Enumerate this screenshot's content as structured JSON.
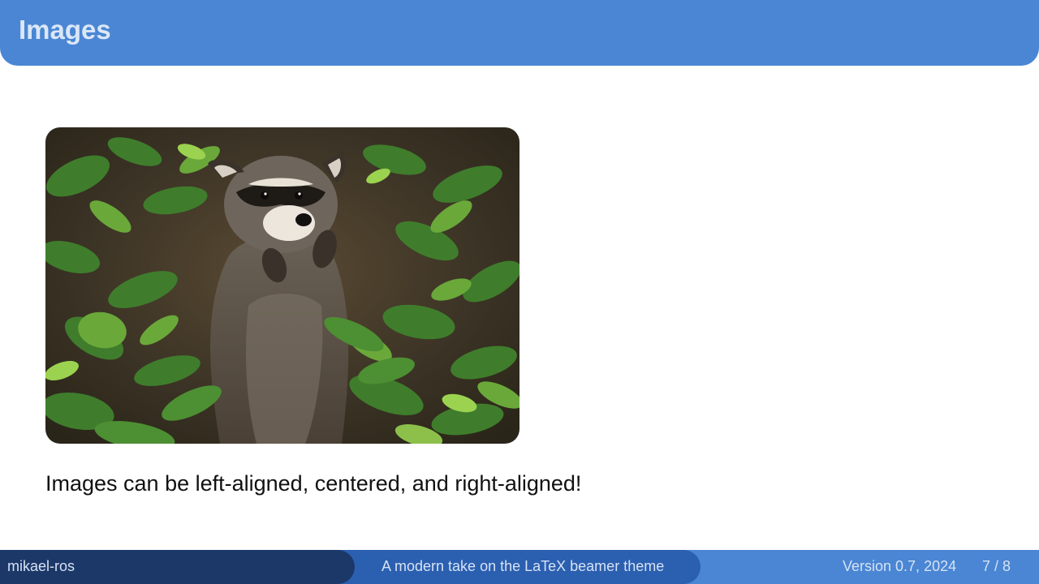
{
  "header": {
    "title": "Images"
  },
  "main": {
    "image": {
      "subject": "raccoon-among-green-plants"
    },
    "caption": "Images can be left-aligned, centered, and right-aligned!"
  },
  "footer": {
    "author": "mikael-ros",
    "subtitle": "A modern take on the LaTeX beamer theme",
    "version": "Version 0.7, 2024",
    "page": "7 / 8"
  },
  "colors": {
    "header_bg": "#4a86d4",
    "header_text": "#dbe7f7",
    "footer_dark": "#1c3869",
    "footer_mid": "#2b5fb0",
    "footer_light": "#4a86d4"
  }
}
